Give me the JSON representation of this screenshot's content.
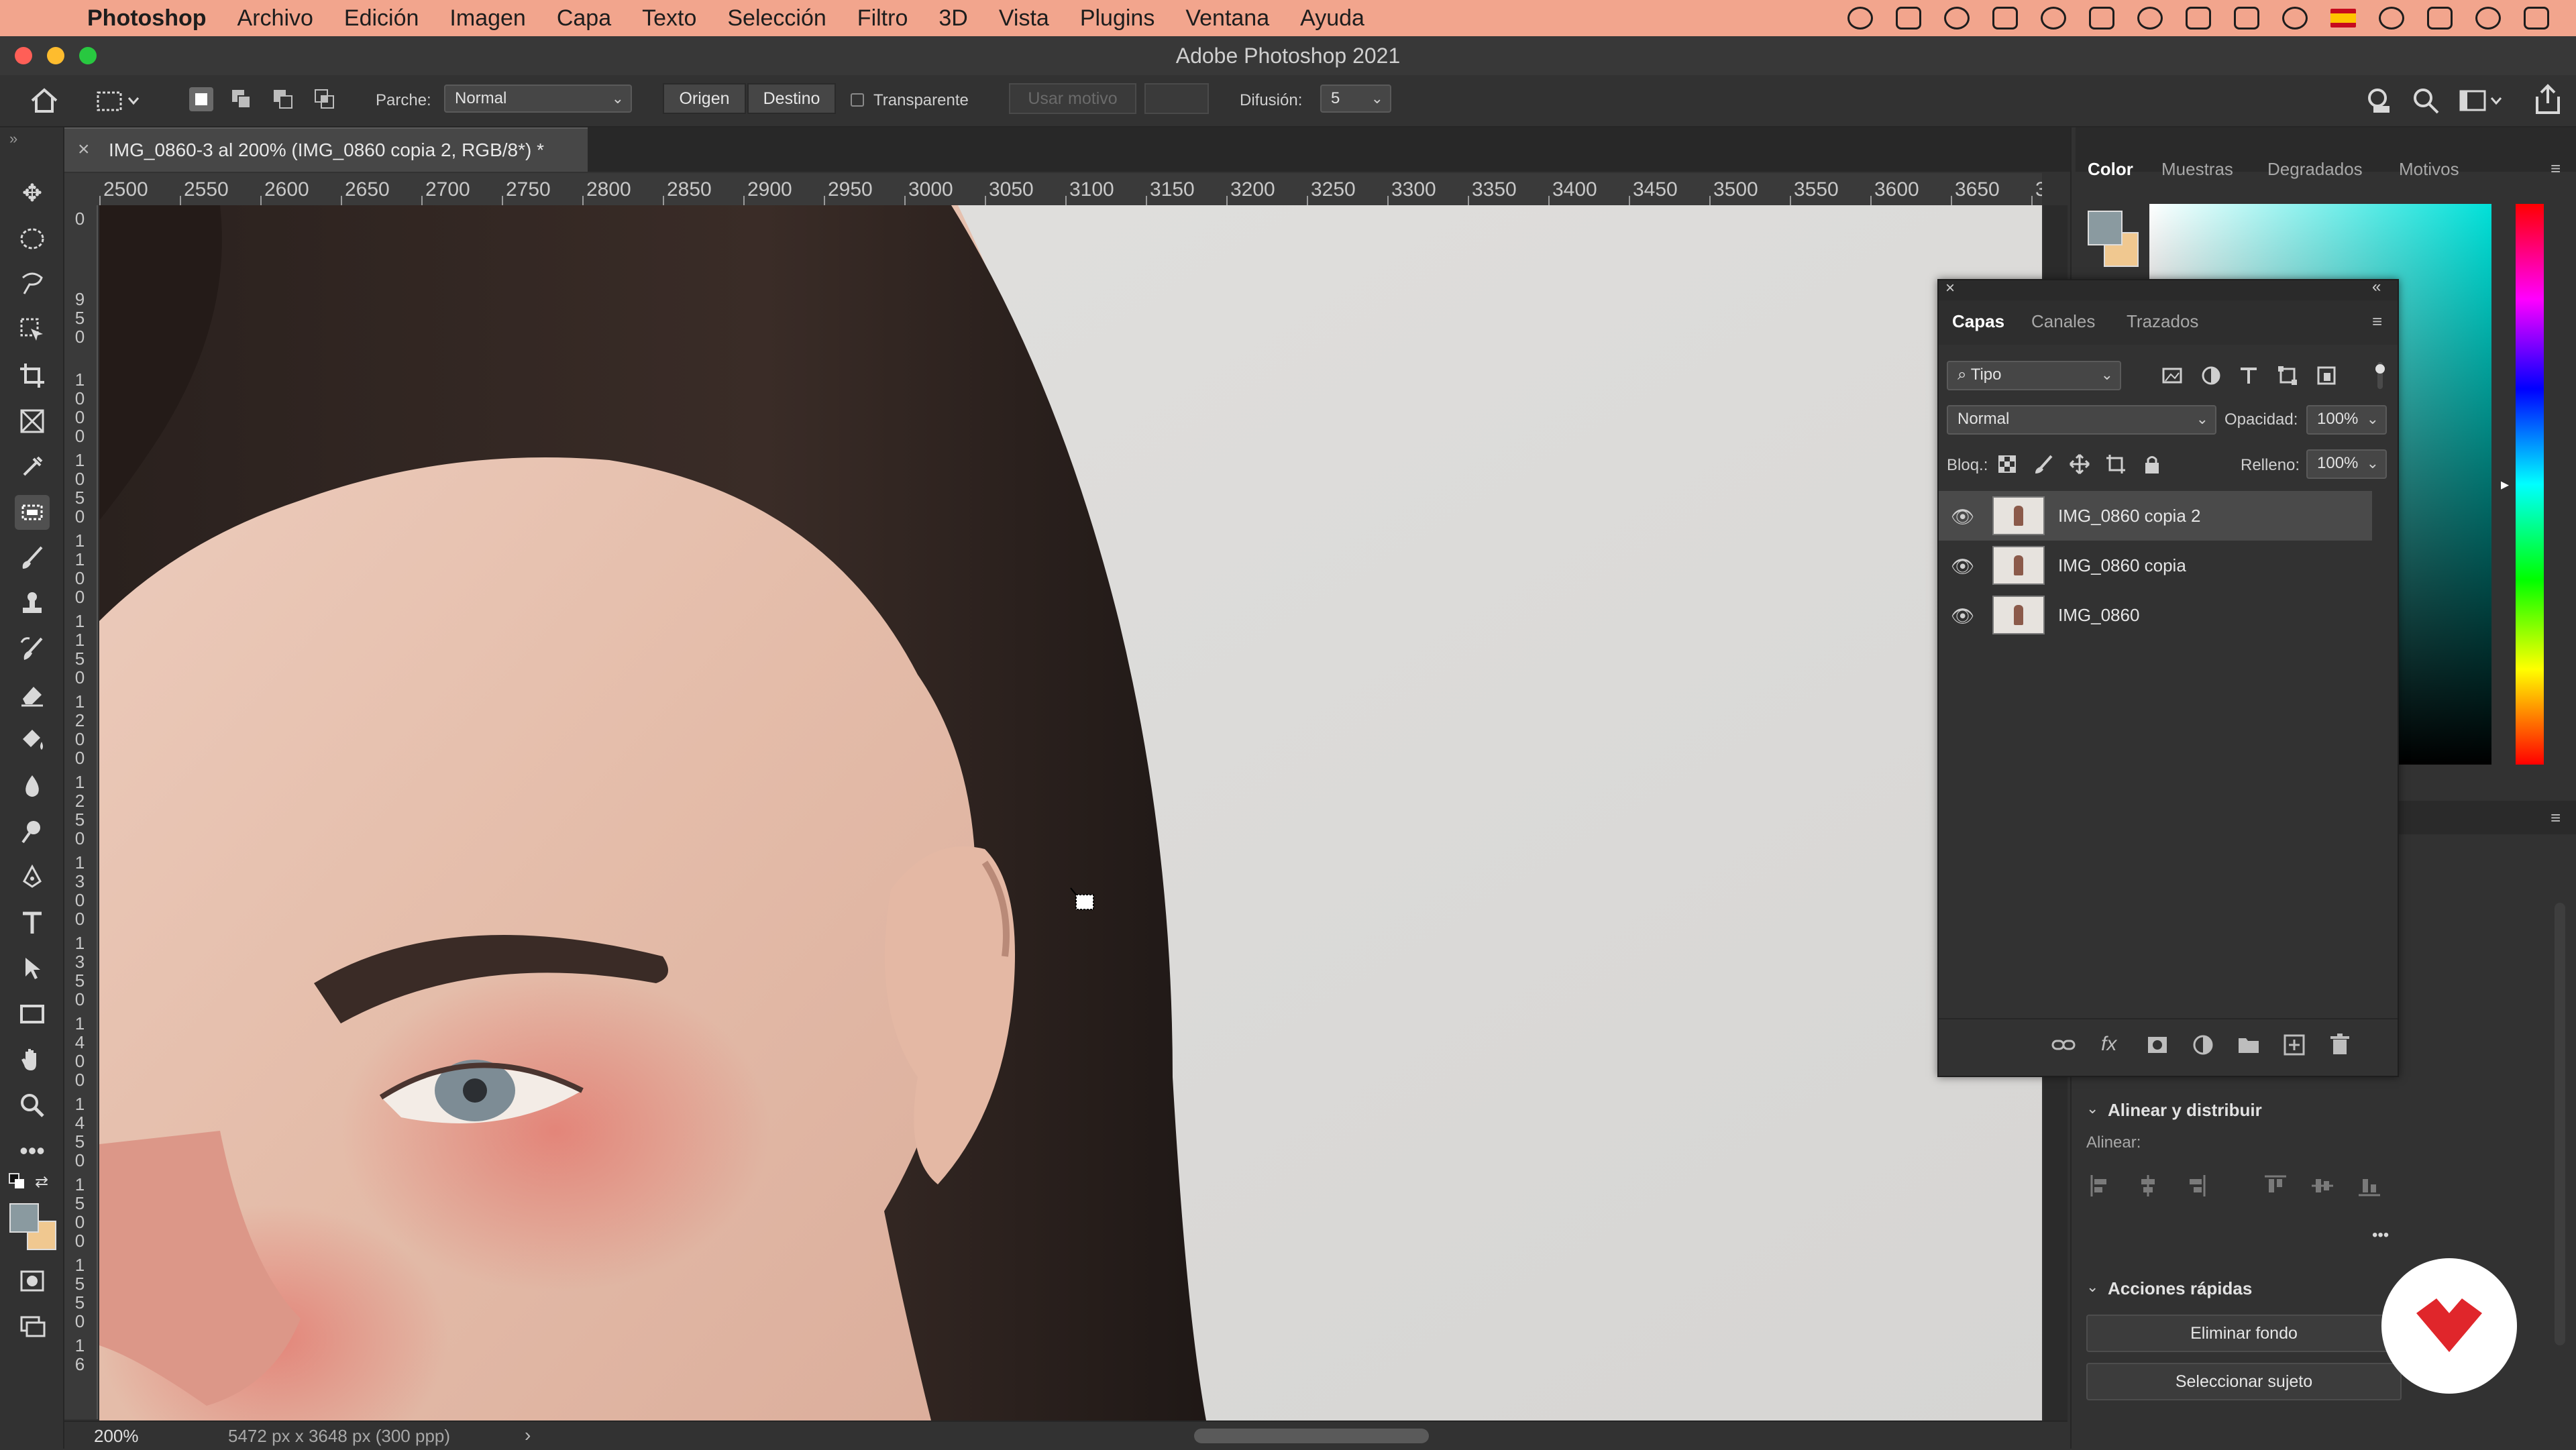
{
  "menubar": {
    "app": "Photoshop",
    "items": [
      "Archivo",
      "Edición",
      "Imagen",
      "Capa",
      "Texto",
      "Selección",
      "Filtro",
      "3D",
      "Vista",
      "Plugins",
      "Ventana",
      "Ayuda"
    ],
    "background": "#f2a58d"
  },
  "window": {
    "title": "Adobe Photoshop 2021"
  },
  "options": {
    "parche_label": "Parche:",
    "parche_value": "Normal",
    "origen": "Origen",
    "destino": "Destino",
    "transparente": "Transparente",
    "usar_motivo": "Usar motivo",
    "difusion_label": "Difusión:",
    "difusion_value": "5"
  },
  "document": {
    "tab_title": "IMG_0860-3 al 200% (IMG_0860 copia 2, RGB/8*) *",
    "ruler_h": [
      "2500",
      "2550",
      "2600",
      "2650",
      "2700",
      "2750",
      "2800",
      "2850",
      "2900",
      "2950",
      "3000",
      "3050",
      "3100",
      "3150",
      "3200",
      "3250",
      "3300",
      "3350",
      "3400",
      "3450",
      "3500",
      "3550",
      "3600",
      "3650",
      "3"
    ],
    "ruler_v": [
      "0",
      "9 5 0",
      "1 0 0 0",
      "1 0 5 0",
      "1 1 0 0",
      "1 1 5 0",
      "1 2 0 0",
      "1 2 5 0",
      "1 3 0 0",
      "1 3 5 0",
      "1 4 0 0",
      "1 4 5 0",
      "1 5 0 0",
      "1 5 5 0",
      "1 6"
    ]
  },
  "statusbar": {
    "zoom": "200%",
    "info": "5472 px x 3648 px (300 ppp)",
    "arrow": "›"
  },
  "color_panel": {
    "tabs": [
      "Color",
      "Muestras",
      "Degradados",
      "Motivos"
    ],
    "foreground": "#8a9aa0",
    "background": "#f0c890"
  },
  "layers_panel": {
    "tabs": [
      "Capas",
      "Canales",
      "Trazados"
    ],
    "filter": "Tipo",
    "blend_mode": "Normal",
    "opacity_label": "Opacidad:",
    "opacity": "100%",
    "lock_label": "Bloq.:",
    "fill_label": "Relleno:",
    "fill": "100%",
    "layers": [
      {
        "name": "IMG_0860 copia 2",
        "selected": true
      },
      {
        "name": "IMG_0860 copia",
        "selected": false
      },
      {
        "name": "IMG_0860",
        "selected": false
      }
    ],
    "footer_fx": "fx"
  },
  "properties": {
    "align_section": "Alinear y distribuir",
    "align_label": "Alinear:",
    "more": "•••",
    "quick_actions": "Acciones rápidas",
    "remove_bg": "Eliminar fondo",
    "select_subject": "Seleccionar sujeto"
  }
}
